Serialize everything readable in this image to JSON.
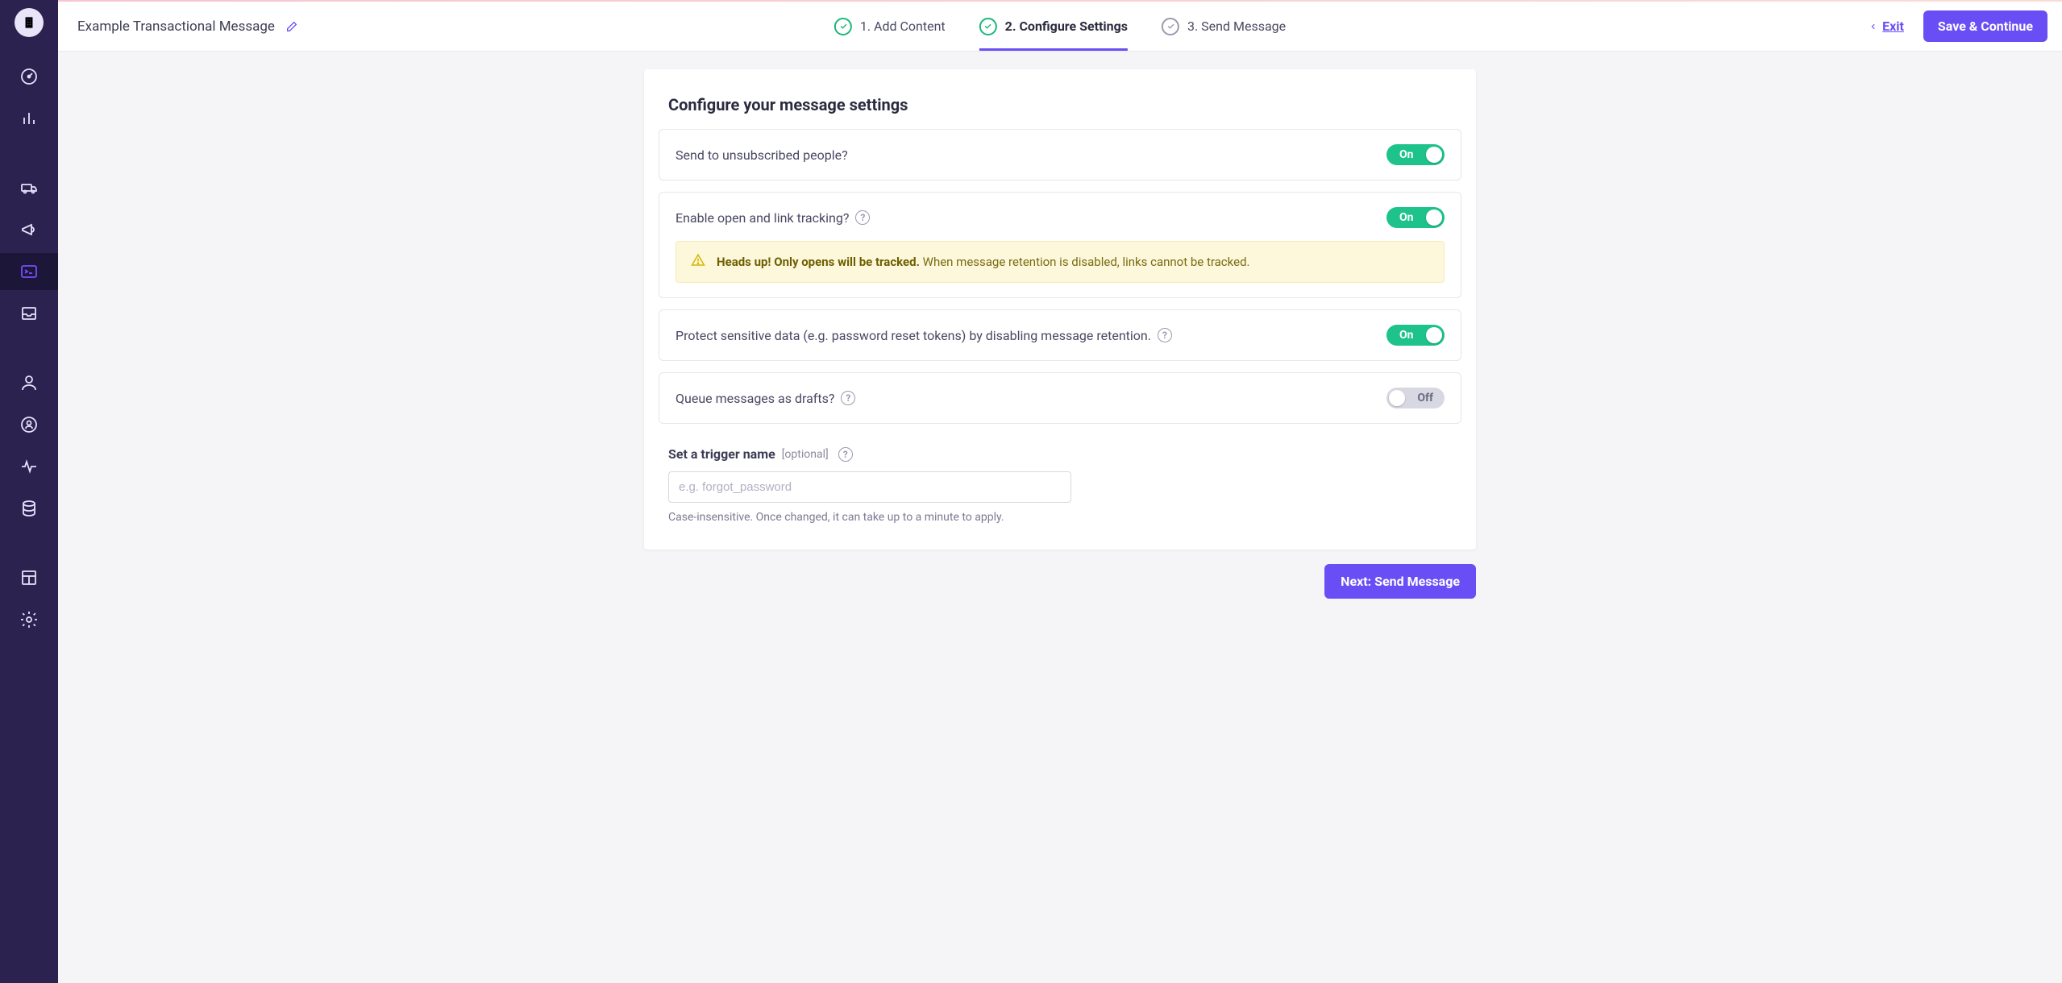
{
  "header": {
    "title": "Example Transactional Message",
    "exit_label": "Exit",
    "save_label": "Save & Continue"
  },
  "steps": [
    {
      "label": "1. Add Content",
      "state": "done"
    },
    {
      "label": "2. Configure Settings",
      "state": "current"
    },
    {
      "label": "3. Send Message",
      "state": "future"
    }
  ],
  "panel": {
    "heading": "Configure your message settings"
  },
  "settings": {
    "unsubscribed": {
      "label": "Send to unsubscribed people?",
      "value": "On"
    },
    "tracking": {
      "label": "Enable open and link tracking?",
      "value": "On",
      "alert_strong": "Heads up! Only opens will be tracked.",
      "alert_rest": " When message retention is disabled, links cannot be tracked."
    },
    "retention": {
      "label": "Protect sensitive data (e.g. password reset tokens) by disabling message retention.",
      "value": "On"
    },
    "drafts": {
      "label": "Queue messages as drafts?",
      "value": "Off"
    }
  },
  "trigger": {
    "section_label": "Set a trigger name",
    "optional": "[optional]",
    "placeholder": "e.g. forgot_password",
    "value": "",
    "hint": "Case-insensitive. Once changed, it can take up to a minute to apply."
  },
  "footer": {
    "next_label": "Next: Send Message"
  }
}
